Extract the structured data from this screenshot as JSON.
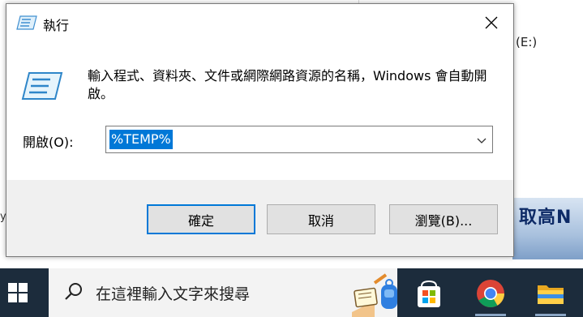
{
  "background": {
    "drive_label": "(E:)",
    "edge_text": "y",
    "banner_text": "取高N"
  },
  "dialog": {
    "title": "執行",
    "description": "輸入程式、資料夾、文件或網際網路資源的名稱，Windows 會自動開啟。",
    "open_label": "開啟(O):",
    "open_value": "%TEMP%",
    "buttons": {
      "ok": "確定",
      "cancel": "取消",
      "browse": "瀏覽(B)..."
    }
  },
  "taskbar": {
    "search_placeholder": "在這裡輸入文字來搜尋",
    "apps": [
      "microsoft-store-icon",
      "chrome-icon",
      "file-explorer-icon"
    ]
  },
  "colors": {
    "accent": "#0078d7",
    "taskbar": "#1c2c3c",
    "dialog_footer": "#f0f0f0"
  }
}
